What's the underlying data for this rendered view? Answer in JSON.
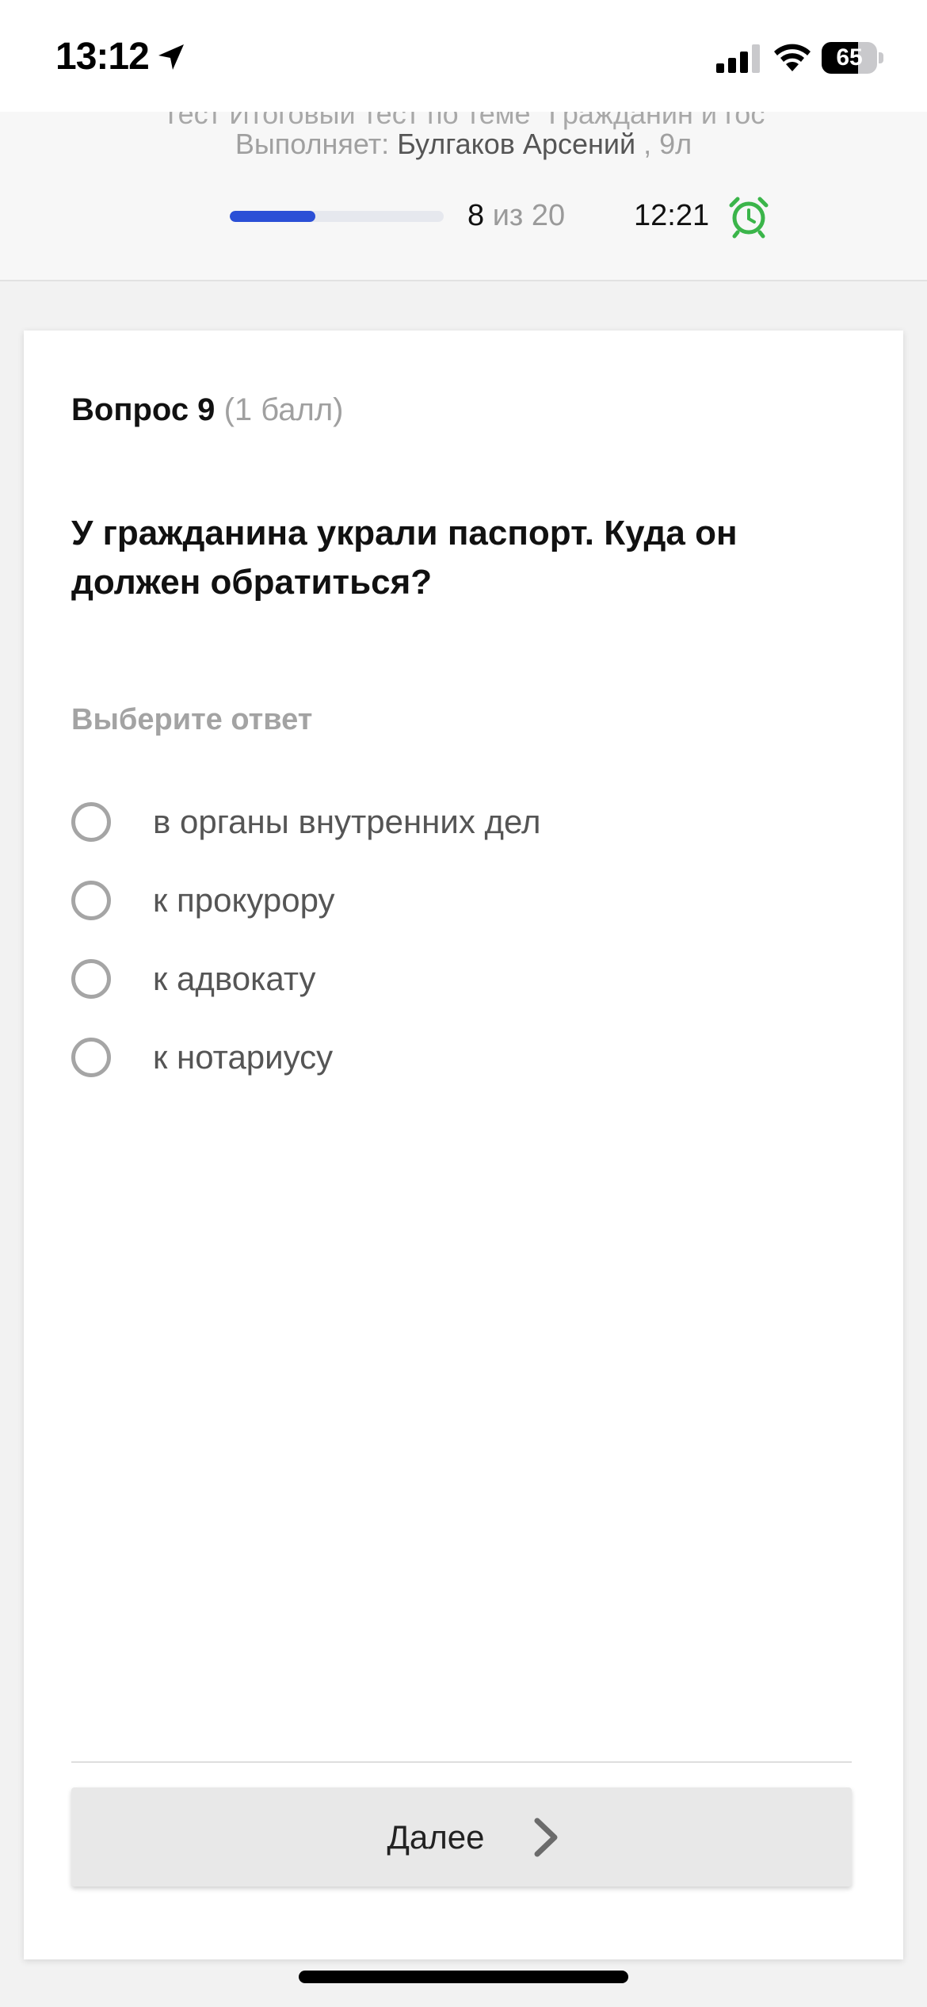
{
  "status_bar": {
    "time": "13:12",
    "battery": "65",
    "battery_level": 0.65
  },
  "header": {
    "test_title": "Тест Итоговый тест по теме \"Гражданин и гос",
    "performer_label": "Выполняет:",
    "performer_name": "Булгаков Арсений",
    "performer_class": ", 9л",
    "progress": {
      "current": "8",
      "of_label": "из 20",
      "fraction": 0.4
    },
    "timer": "12:21"
  },
  "question": {
    "label": "Вопрос 9",
    "points": "(1 балл)",
    "text": "У гражданина украли паспорт. Куда он должен обратиться?",
    "choose_label": "Выберите ответ",
    "options": [
      {
        "label": "в органы внутренних дел"
      },
      {
        "label": "к прокурору"
      },
      {
        "label": "к адвокату"
      },
      {
        "label": "к нотариусу"
      }
    ]
  },
  "footer": {
    "next_label": "Далее"
  },
  "colors": {
    "accent": "#2b4fd6",
    "timer_icon": "#3bb54a"
  }
}
